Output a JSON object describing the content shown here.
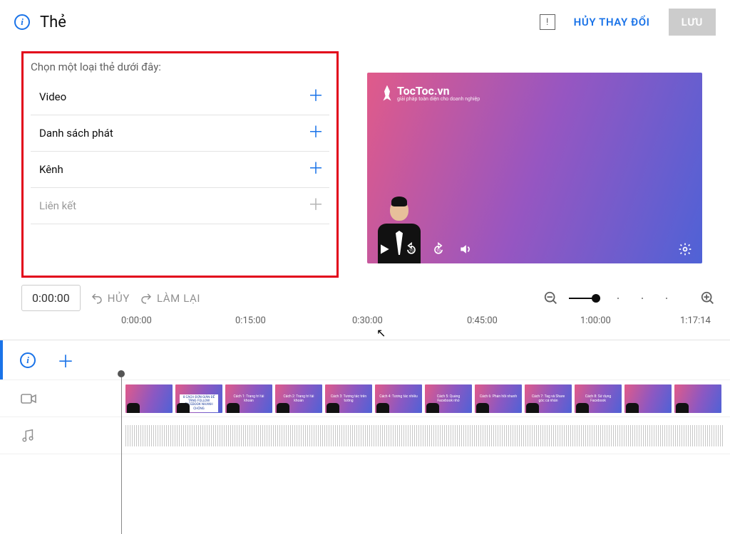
{
  "header": {
    "info_glyph": "i",
    "title": "Thẻ",
    "warn_glyph": "!",
    "cancel_label": "HỦY THAY ĐỔI",
    "save_label": "LƯU"
  },
  "card_panel": {
    "instruction": "Chọn một loại thẻ dưới đây:",
    "items": [
      {
        "label": "Video",
        "enabled": true
      },
      {
        "label": "Danh sách phát",
        "enabled": true
      },
      {
        "label": "Kênh",
        "enabled": true
      },
      {
        "label": "Liên kết",
        "enabled": false
      }
    ]
  },
  "preview": {
    "brand": "TocToc.vn",
    "tagline": "giải pháp toàn diện cho doanh nghiệp"
  },
  "timeline": {
    "current_time": "0:00:00",
    "undo_label": "HỦY",
    "redo_label": "LÀM LẠI",
    "ticks": [
      "0:00:00",
      "0:15:00",
      "0:30:00",
      "0:45:00",
      "1:00:00",
      "1:17:14"
    ],
    "thumbs": [
      "",
      "8 CÁCH ĐƠN GIẢN ĐỂ TĂNG FOLLOW FACEBOOK NHANH CHÓNG",
      "Cách 1: Trang trí tài khoản",
      "Cách 2: Trang trí tài khoản",
      "Cách 3: Tương tác trên tường",
      "Cách 4: Tương tác nhiều",
      "Cách 5: Quảng Facebook nhỏ",
      "Cách 6: Phản hồi nhanh",
      "Cách 7: Tag và Share góc cá nhân",
      "Cách 8: Sử dụng Facebook",
      "",
      "",
      ""
    ]
  }
}
